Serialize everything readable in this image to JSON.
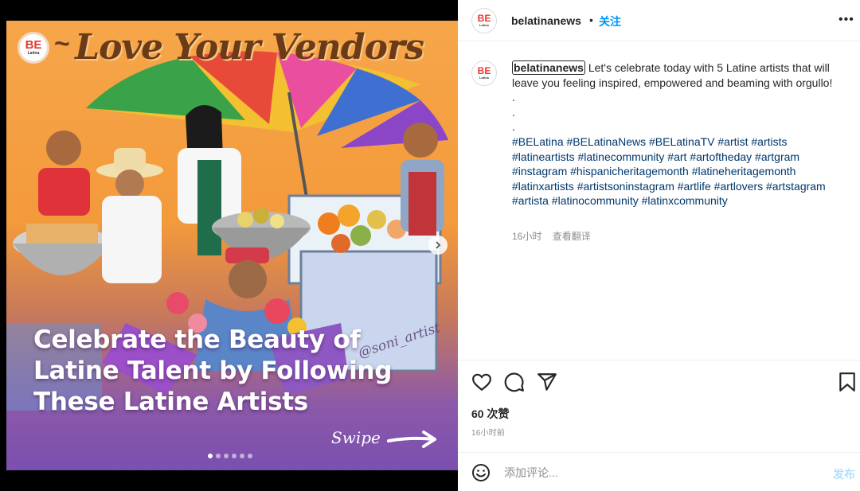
{
  "media": {
    "logo_text": "BE",
    "logo_sub": "Latina",
    "art_title": "Love Your Vendors",
    "tilde": "~",
    "headline": "Celebrate the Beauty of Latine Talent by Following These Latine Artists",
    "signature": "@soni_artist",
    "swipe_label": "Swipe",
    "carousel": {
      "count": 6,
      "active_index": 0
    }
  },
  "header": {
    "username": "belatinanews",
    "separator": "•",
    "follow_label": "关注",
    "more_label": "•••"
  },
  "post": {
    "username": "belatinanews",
    "caption": "Let's celebrate today with 5 Latine artists that will leave you feeling inspired, empowered and beaming with orgullo!",
    "dot_lines": [
      ".",
      ".",
      "."
    ],
    "hashtags": "#BELatina #BELatinaNews #BELatinaTV #artist #artists #latineartists #latinecommunity #art #artoftheday #artgram #instagram #hispanicheritagemonth #latineheritagemonth #latinxartists #artistsoninstagram #artlife #artlovers #artstagram #artista #latinocommunity #latinxcommunity",
    "time": "16小时",
    "see_translation": "查看翻译"
  },
  "stats": {
    "likes": "60 次赞",
    "time_ago": "16小时前"
  },
  "comment": {
    "placeholder": "添加评论...",
    "post_label": "发布"
  },
  "colors": {
    "follow_blue": "#0095f6",
    "hashtag_blue": "#00376b",
    "brand_red": "#e8382f",
    "post_disabled": "#b2dffc"
  },
  "icons": {
    "like": "heart-icon",
    "comment": "comment-bubble-icon",
    "share": "paper-plane-icon",
    "save": "bookmark-icon",
    "emoji": "smiley-icon",
    "next": "chevron-right-icon"
  }
}
